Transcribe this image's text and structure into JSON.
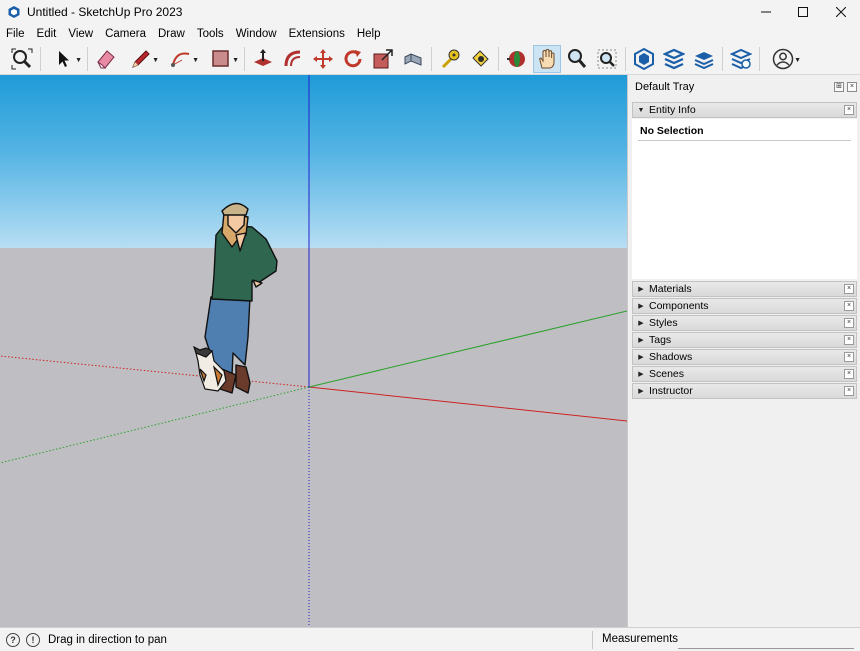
{
  "window": {
    "title": "Untitled - SketchUp Pro 2023",
    "icon": "sketchup-logo-icon",
    "controls": [
      "minimize-icon",
      "maximize-icon",
      "close-icon"
    ]
  },
  "menu": [
    "File",
    "Edit",
    "View",
    "Camera",
    "Draw",
    "Tools",
    "Window",
    "Extensions",
    "Help"
  ],
  "toolbar": {
    "tools": [
      {
        "name": "zoom-extents-icon"
      },
      {
        "name": "select-icon",
        "dropdown": true
      },
      {
        "name": "eraser-icon"
      },
      {
        "name": "pencil-line-icon",
        "dropdown": true
      },
      {
        "name": "arc-icon",
        "dropdown": true
      },
      {
        "name": "rectangle-icon",
        "dropdown": true
      },
      {
        "name": "push-pull-icon"
      },
      {
        "name": "offset-icon"
      },
      {
        "name": "move-icon"
      },
      {
        "name": "rotate-icon"
      },
      {
        "name": "scale-icon"
      },
      {
        "name": "follow-me-icon"
      },
      {
        "name": "tape-measure-icon"
      },
      {
        "name": "paint-bucket-icon"
      },
      {
        "name": "orbit-icon"
      },
      {
        "name": "pan-icon",
        "active": true
      },
      {
        "name": "zoom-icon"
      },
      {
        "name": "zoom-window-icon"
      },
      {
        "name": "3d-warehouse-icon"
      },
      {
        "name": "extension-warehouse-icon"
      },
      {
        "name": "layout-icon"
      },
      {
        "name": "extension-manager-icon"
      },
      {
        "name": "account-icon",
        "dropdown": true
      }
    ]
  },
  "tray": {
    "title": "Default Tray",
    "entity_info": {
      "label": "Entity Info",
      "content": "No Selection"
    },
    "panels": [
      "Materials",
      "Components",
      "Styles",
      "Tags",
      "Shadows",
      "Scenes",
      "Instructor"
    ]
  },
  "status": {
    "message": "Drag in direction to pan",
    "measurements_label": "Measurements",
    "measurements_value": ""
  },
  "colors": {
    "sky_top": "#1f9bd8",
    "ground": "#bfbfc3",
    "axis_red": "#cc2222",
    "axis_green": "#2aa02a",
    "axis_blue": "#2222cc",
    "active_tool": "#cde4f5"
  }
}
